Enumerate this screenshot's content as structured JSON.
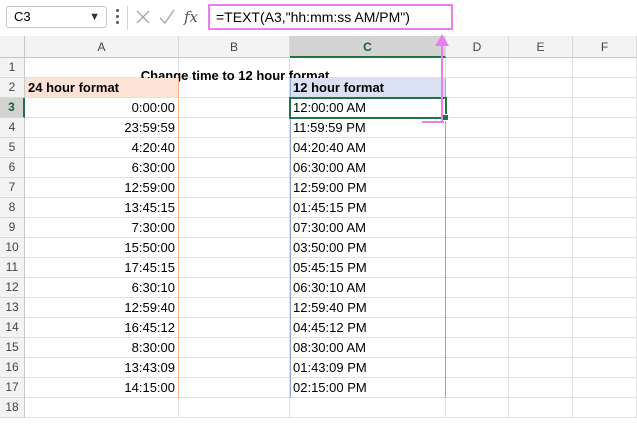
{
  "formula_bar": {
    "name_box": "C3",
    "formula": "=TEXT(A3,\"hh:mm:ss AM/PM\")",
    "fx_label": "fx"
  },
  "columns": [
    "A",
    "B",
    "C",
    "D",
    "E",
    "F"
  ],
  "rows": [
    "1",
    "2",
    "3",
    "4",
    "5",
    "6",
    "7",
    "8",
    "9",
    "10",
    "11",
    "12",
    "13",
    "14",
    "15",
    "16",
    "17",
    "18"
  ],
  "sheet": {
    "title": "Change time to 12 hour format",
    "header_a": "24 hour format",
    "header_c": "12 hour format",
    "times_24": [
      "0:00:00",
      "23:59:59",
      "4:20:40",
      "6:30:00",
      "12:59:00",
      "13:45:15",
      "7:30:00",
      "15:50:00",
      "17:45:15",
      "6:30:10",
      "12:59:40",
      "16:45:12",
      "8:30:00",
      "13:43:09",
      "14:15:00"
    ],
    "times_12": [
      "12:00:00 AM",
      "11:59:59 PM",
      "04:20:40 AM",
      "06:30:00 AM",
      "12:59:00 PM",
      "01:45:15 PM",
      "07:30:00 AM",
      "03:50:00 PM",
      "05:45:15 PM",
      "06:30:10 AM",
      "12:59:40 PM",
      "04:45:12 PM",
      "08:30:00 AM",
      "01:43:09 PM",
      "02:15:00 PM"
    ]
  },
  "colors": {
    "selection": "#217346",
    "callout": "#e97ef0",
    "header_a_fill": "#fde3d6",
    "header_c_fill": "#d9e1f2"
  }
}
